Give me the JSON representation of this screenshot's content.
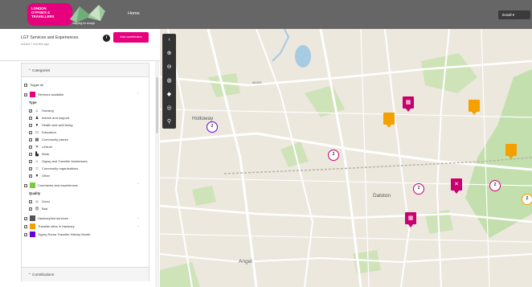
{
  "header": {
    "logo_lines": [
      "LONDON",
      "GYPSIES &",
      "TRAVELLERS"
    ],
    "logo_tagline": "mapping for change",
    "nav_home": "Home",
    "user_label": "Ilesall ▾"
  },
  "sidebar": {
    "title": "LGT Services and Experiences",
    "subtitle": "Added 7 months ago",
    "add_button": "Add contribution",
    "info_icon": "i",
    "categories_header": "Categories",
    "toggle_all": "Toggle all",
    "services_label": "Services available",
    "type_heading": "Type",
    "types": [
      {
        "label": "Housing",
        "icon": "house-icon",
        "glyph": "⌂"
      },
      {
        "label": "Advice and support",
        "icon": "person-icon",
        "glyph": "♟"
      },
      {
        "label": "Health and well-being",
        "icon": "heart-icon",
        "glyph": "♥"
      },
      {
        "label": "Education",
        "icon": "board-icon",
        "glyph": "▭"
      },
      {
        "label": "Community places",
        "icon": "building-icon",
        "glyph": "▦"
      },
      {
        "label": "Leisure",
        "icon": "crossed-tools-icon",
        "glyph": "✕"
      },
      {
        "label": "Work",
        "icon": "factory-icon",
        "glyph": "▙"
      },
      {
        "label": "Gypsy and Traveller businesses",
        "icon": "shop-icon",
        "glyph": "⌂"
      },
      {
        "label": "Community organisations",
        "icon": "star-icon",
        "glyph": "☆"
      },
      {
        "label": "Other",
        "icon": "speech-icon",
        "glyph": "▼"
      }
    ],
    "comments_label": "Comments and experiences",
    "quality_heading": "Quality",
    "quality": [
      {
        "label": "Good",
        "glyph": "☺"
      },
      {
        "label": "Bad",
        "glyph": "☹"
      }
    ],
    "other_layers": [
      {
        "label": "Hackney/led services",
        "color": "#555555"
      },
      {
        "label": "Traveller sites in Hackney",
        "color": "#f3a000"
      },
      {
        "label": "Gypsy Roma Traveller History Month",
        "color": "#6a00d8"
      }
    ],
    "contributions_header": "Contributions"
  },
  "colors": {
    "brand": "#e6007e",
    "services": "#e6007e",
    "comments": "#7ac943",
    "sites": "#f3a000"
  },
  "map": {
    "labels": {
      "holloway": "Holloway",
      "dalston": "Dalston",
      "angel": "Angel",
      "a1201": "A1201"
    },
    "clusters": [
      "2",
      "2",
      "2",
      "2",
      "2"
    ],
    "controls": [
      "collapse-icon",
      "zoom-in-icon",
      "zoom-out-icon",
      "globe-icon",
      "layers-icon",
      "locate-icon",
      "search-icon"
    ]
  }
}
